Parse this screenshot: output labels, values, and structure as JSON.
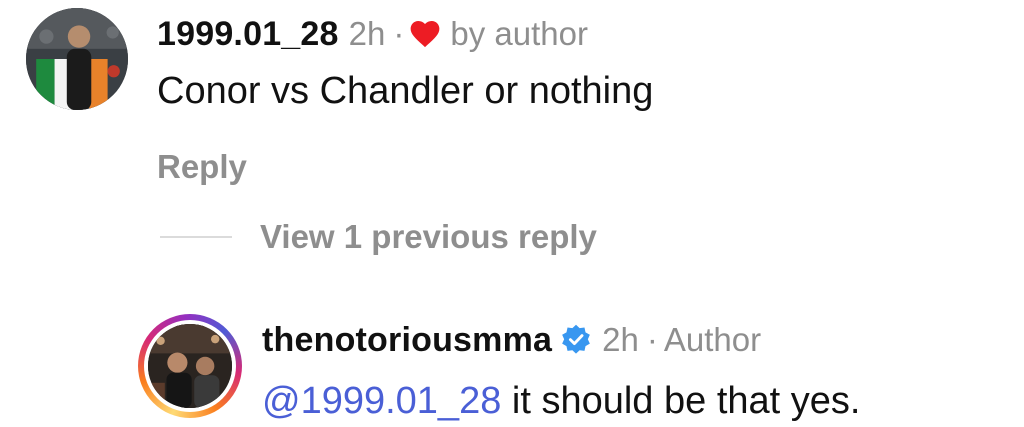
{
  "comment1": {
    "username": "1999.01_28",
    "time": "2h",
    "separator": "·",
    "liked_by": "by author",
    "text": "Conor vs Chandler or nothing",
    "reply_label": "Reply"
  },
  "thread": {
    "view_previous_label": "View 1 previous reply"
  },
  "comment2": {
    "username": "thenotoriousmma",
    "time": "2h",
    "separator": "·",
    "author_label": "Author",
    "mention": "@1999.01_28",
    "text": " it should be that yes."
  },
  "colors": {
    "secondary_text": "#8e8e8e",
    "mention": "#4a5fd6",
    "heart": "#ed1c24",
    "verified": "#3897f0"
  },
  "icons": {
    "heart": "heart-icon",
    "verified": "verified-badge-icon"
  }
}
